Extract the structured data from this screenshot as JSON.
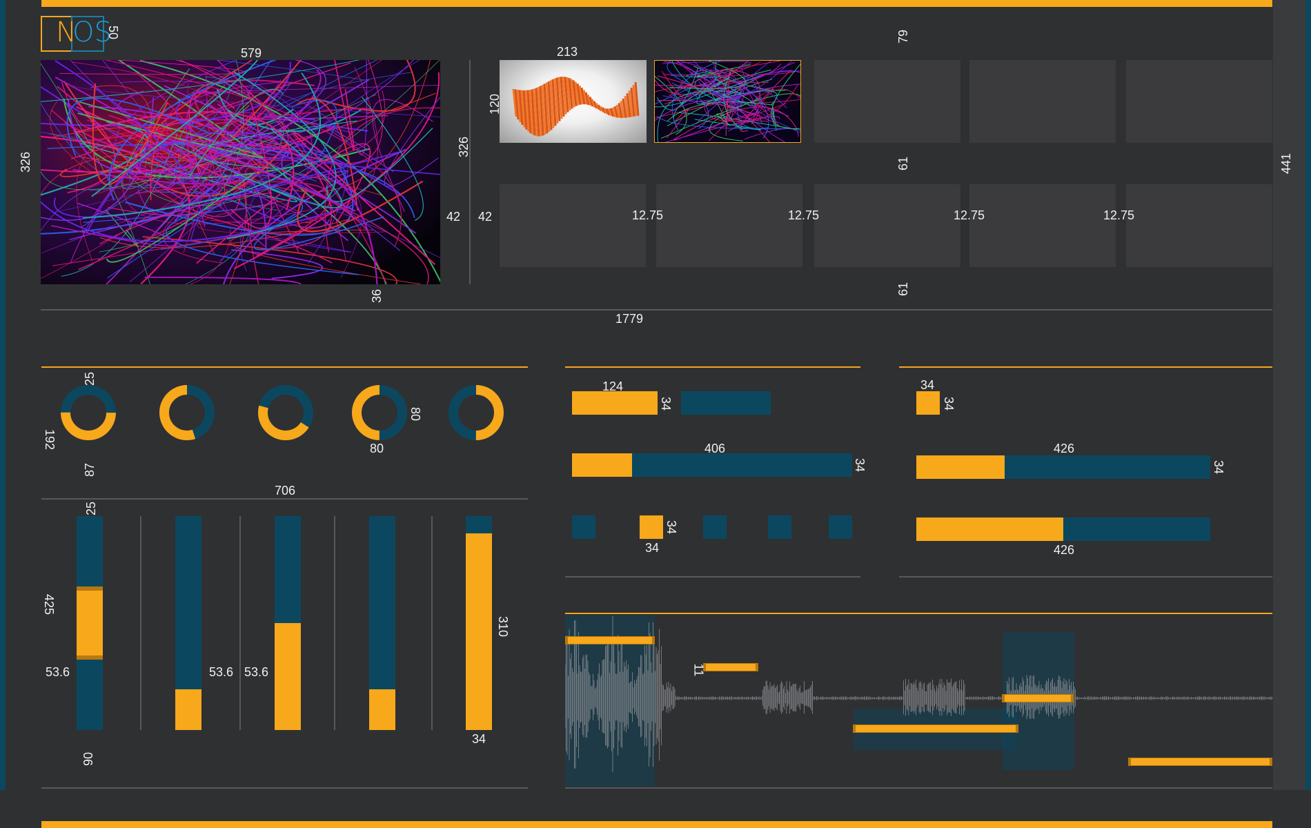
{
  "logo": {
    "text_a": "N",
    "text_b": "OS"
  },
  "colors": {
    "accent": "#f7a81b",
    "blue": "#0b4860",
    "bg": "#2f3032",
    "tile": "#3b3b3d"
  },
  "labels": {
    "logo_h": "50",
    "hero_w": "579",
    "hero_h": "326",
    "hero_bottom_gap": "36",
    "gap_left": "42",
    "gap_right": "42",
    "divider_h": "326",
    "thumb_w": "213",
    "thumb_h": "120",
    "top_gap": "79",
    "row_gap": "61",
    "bottom_gap": "61",
    "right_h": "441",
    "col_gap_1": "12.75",
    "col_gap_2": "12.75",
    "col_gap_3": "12.75",
    "col_gap_4": "12.75",
    "total_w": "1779",
    "donut_top": "25",
    "donut_side": "192",
    "donut_bottom": "87",
    "donut_r": "80",
    "donut_b": "80",
    "panel_w": "706",
    "vbar_top": "25",
    "vbar_side": "425",
    "vbar_gap1": "53.6",
    "vbar_gap2": "53.6",
    "vbar_gap3": "53.6",
    "vbar_bottom": "90",
    "vbar_h": "310",
    "vbar_w": "34",
    "hb_top": "124",
    "hb_top_h": "34",
    "hb_mid": "406",
    "hb_mid_h": "34",
    "hb_sq_h": "34",
    "hb_sq_w": "34",
    "r_sq_w": "34",
    "r_sq_h": "34",
    "r_mid": "426",
    "r_mid_h": "34",
    "r_bot": "426",
    "wave_h": "11"
  },
  "donuts": [
    {
      "fill": 0.5,
      "start": 0.25
    },
    {
      "fill": 0.58,
      "start": 0.45
    },
    {
      "fill": 0.45,
      "start": 0.34
    },
    {
      "fill": 0.72,
      "start": 0.5
    },
    {
      "fill": 0.5,
      "start": 0.0
    }
  ],
  "vbars": [
    {
      "fill_from": 0.33,
      "fill_to": 0.67,
      "markers": true
    },
    {
      "fill_from": 0.0,
      "fill_to": 0.19
    },
    {
      "fill_from": 0.0,
      "fill_to": 0.5
    },
    {
      "fill_from": 0.0,
      "fill_to": 0.19
    },
    {
      "fill_from": 0.0,
      "fill_to": 0.92
    }
  ]
}
